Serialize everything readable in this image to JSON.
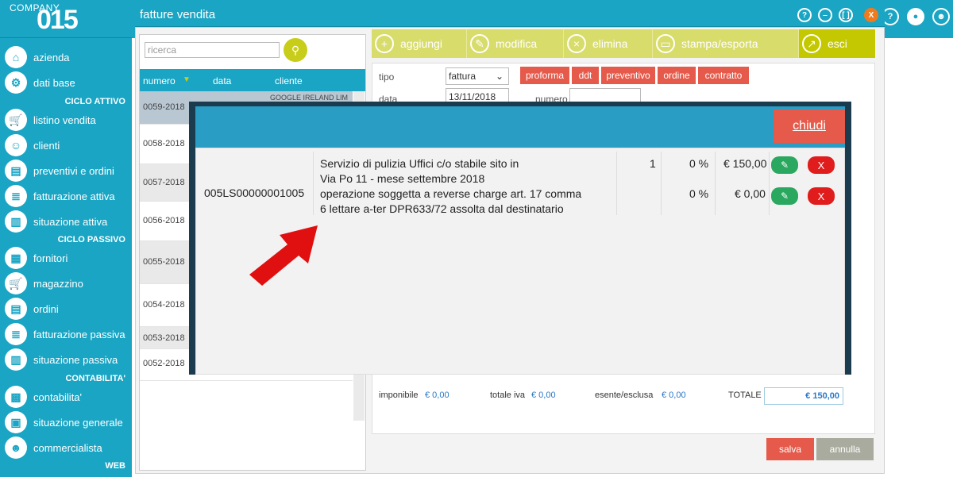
{
  "logo": {
    "company": "COMPANY",
    "number": "015"
  },
  "sidebar": {
    "items": [
      {
        "label": "azienda",
        "icon": "home-icon"
      },
      {
        "label": "dati base",
        "icon": "gear-icon"
      },
      {
        "label": "listino vendita",
        "icon": "cart-icon"
      },
      {
        "label": "clienti",
        "icon": "users-icon"
      },
      {
        "label": "preventivi e ordini",
        "icon": "document-icon"
      },
      {
        "label": "fatturazione attiva",
        "icon": "invoice-icon"
      },
      {
        "label": "situazione attiva",
        "icon": "chart-icon"
      },
      {
        "label": "fornitori",
        "icon": "supplier-icon"
      },
      {
        "label": "magazzino",
        "icon": "cart-icon"
      },
      {
        "label": "ordini",
        "icon": "document-icon"
      },
      {
        "label": "fatturazione passiva",
        "icon": "invoice-icon"
      },
      {
        "label": "situazione passiva",
        "icon": "chart-icon"
      },
      {
        "label": "contabilita'",
        "icon": "calculator-icon"
      },
      {
        "label": "situazione generale",
        "icon": "report-icon"
      },
      {
        "label": "commercialista",
        "icon": "person-icon"
      }
    ],
    "sections": {
      "ciclo_attivo": "CICLO ATTIVO",
      "ciclo_passivo": "CICLO PASSIVO",
      "contabilita": "CONTABILITA'",
      "web": "WEB"
    }
  },
  "window": {
    "title": "fatture vendita",
    "close_label": "X"
  },
  "search": {
    "placeholder": "ricerca"
  },
  "list": {
    "headers": {
      "numero": "numero",
      "data": "data",
      "cliente": "cliente"
    },
    "first_client": "GOOGLE IRELAND LIM",
    "rows": [
      "0059-2018",
      "0058-2018",
      "0057-2018",
      "0056-2018",
      "0055-2018",
      "0054-2018",
      "0053-2018",
      "0052-2018"
    ]
  },
  "toolbar": {
    "aggiungi": "aggiungi",
    "modifica": "modifica",
    "elimina": "elimina",
    "stampa": "stampa/esporta",
    "esci": "esci"
  },
  "form": {
    "tipo_label": "tipo",
    "tipo_value": "fattura",
    "data_label": "data",
    "data_value": "13/11/2018",
    "numero_label": "numero",
    "doc_types": [
      "proforma",
      "ddt",
      "preventivo",
      "ordine",
      "contratto"
    ]
  },
  "totals": {
    "imponibile_label": "imponibile",
    "imponibile": "€ 0,00",
    "iva_label": "totale iva",
    "iva": "€ 0,00",
    "esente_label": "esente/esclusa",
    "esente": "€ 0,00",
    "totale_label": "TOTALE",
    "totale": "€ 150,00"
  },
  "actions": {
    "salva": "salva",
    "annulla": "annulla"
  },
  "modal": {
    "close_label": "chiudi",
    "code": "005LS00000001005",
    "line1": "Servizio di pulizia Uffici c/o stabile sito in",
    "line2": "Via Po 11 - mese settembre 2018",
    "line3": "operazione soggetta a reverse charge art. 17 comma",
    "line4": "6 lettare a-ter DPR633/72 assolta dal destinatario",
    "row1": {
      "qty": "1",
      "vat": "0 %",
      "amount": "€ 150,00"
    },
    "row2": {
      "vat": "0 %",
      "amount": "€ 0,00"
    },
    "delete_label": "X"
  },
  "colors": {
    "accent": "#1aa5c4",
    "toolbar": "#d8dc6a",
    "danger": "#e55a4a",
    "ok": "#2ba860"
  }
}
